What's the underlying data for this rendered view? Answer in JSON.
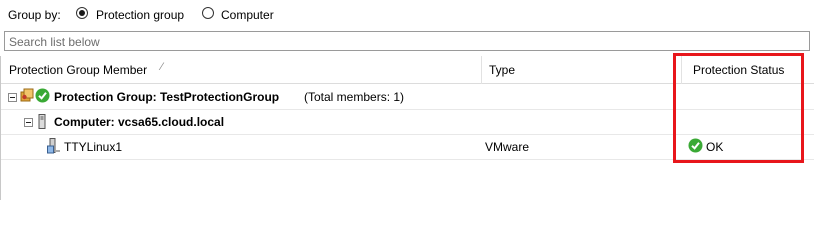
{
  "groupby": {
    "label": "Group by:",
    "options": [
      {
        "label": "Protection group",
        "selected": true
      },
      {
        "label": "Computer",
        "selected": false
      }
    ]
  },
  "search": {
    "placeholder": "Search list below"
  },
  "columns": {
    "member": "Protection Group Member",
    "type": "Type",
    "status": "Protection Status"
  },
  "group_row": {
    "name": "Protection Group: TestProtectionGroup",
    "members": "(Total members: 1)"
  },
  "computer_row": {
    "name": "Computer: vcsa65.cloud.local"
  },
  "item_row": {
    "name": "TTYLinux1",
    "type": "VMware",
    "status": "OK"
  },
  "colors": {
    "ok_green": "#3aa935",
    "highlight_red": "#e8161b"
  },
  "icons": [
    "protection-group-icon",
    "ok-check-icon",
    "server-icon",
    "vm-icon"
  ]
}
